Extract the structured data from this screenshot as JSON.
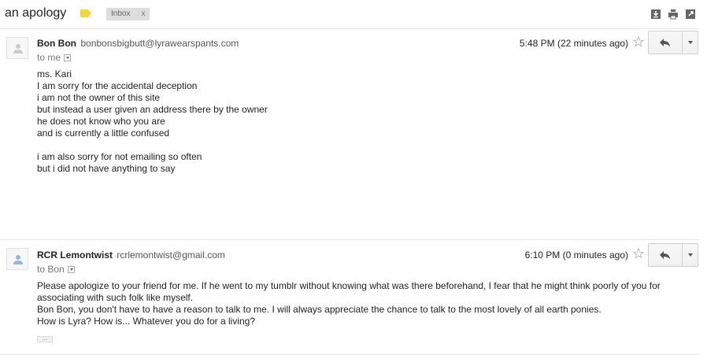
{
  "thread": {
    "subject": "an apology",
    "label_color": "#f3d34a",
    "inbox_chip": "Inbox",
    "inbox_chip_close": "x",
    "toolbar_icons": [
      "download-icon",
      "print-icon",
      "new-window-icon"
    ]
  },
  "messages": [
    {
      "sender_name": "Bon Bon",
      "sender_email": "bonbonsbigbutt@lyrawearspants.com",
      "to_line": "to me",
      "time": "5:48 PM (22 minutes ago)",
      "body": [
        "ms. Kari",
        "I am sorry for the accidental deception",
        "i am not the owner of this site",
        "but instead a user given an address there by the owner",
        "he does not know who you are",
        "and is currently a little confused",
        "",
        "i am also sorry for not emailing so often",
        "but i did not have anything to say"
      ]
    },
    {
      "sender_name": "RCR Lemontwist",
      "sender_email": "rcrlemontwist@gmail.com",
      "to_line": "to Bon",
      "time": "6:10 PM (0 minutes ago)",
      "body": [
        "Please apologize to your friend for me. If he went to my tumblr without knowing what was there beforehand, I fear that he might think poorly of you for associating with such folk like myself.",
        "Bon Bon, you don't have to have a reason to talk to me. I will always appreciate the chance to talk to the most lovely of all earth ponies.",
        "How is Lyra? How is... Whatever you do for a living?"
      ],
      "trimmed_content_label": "..."
    }
  ]
}
